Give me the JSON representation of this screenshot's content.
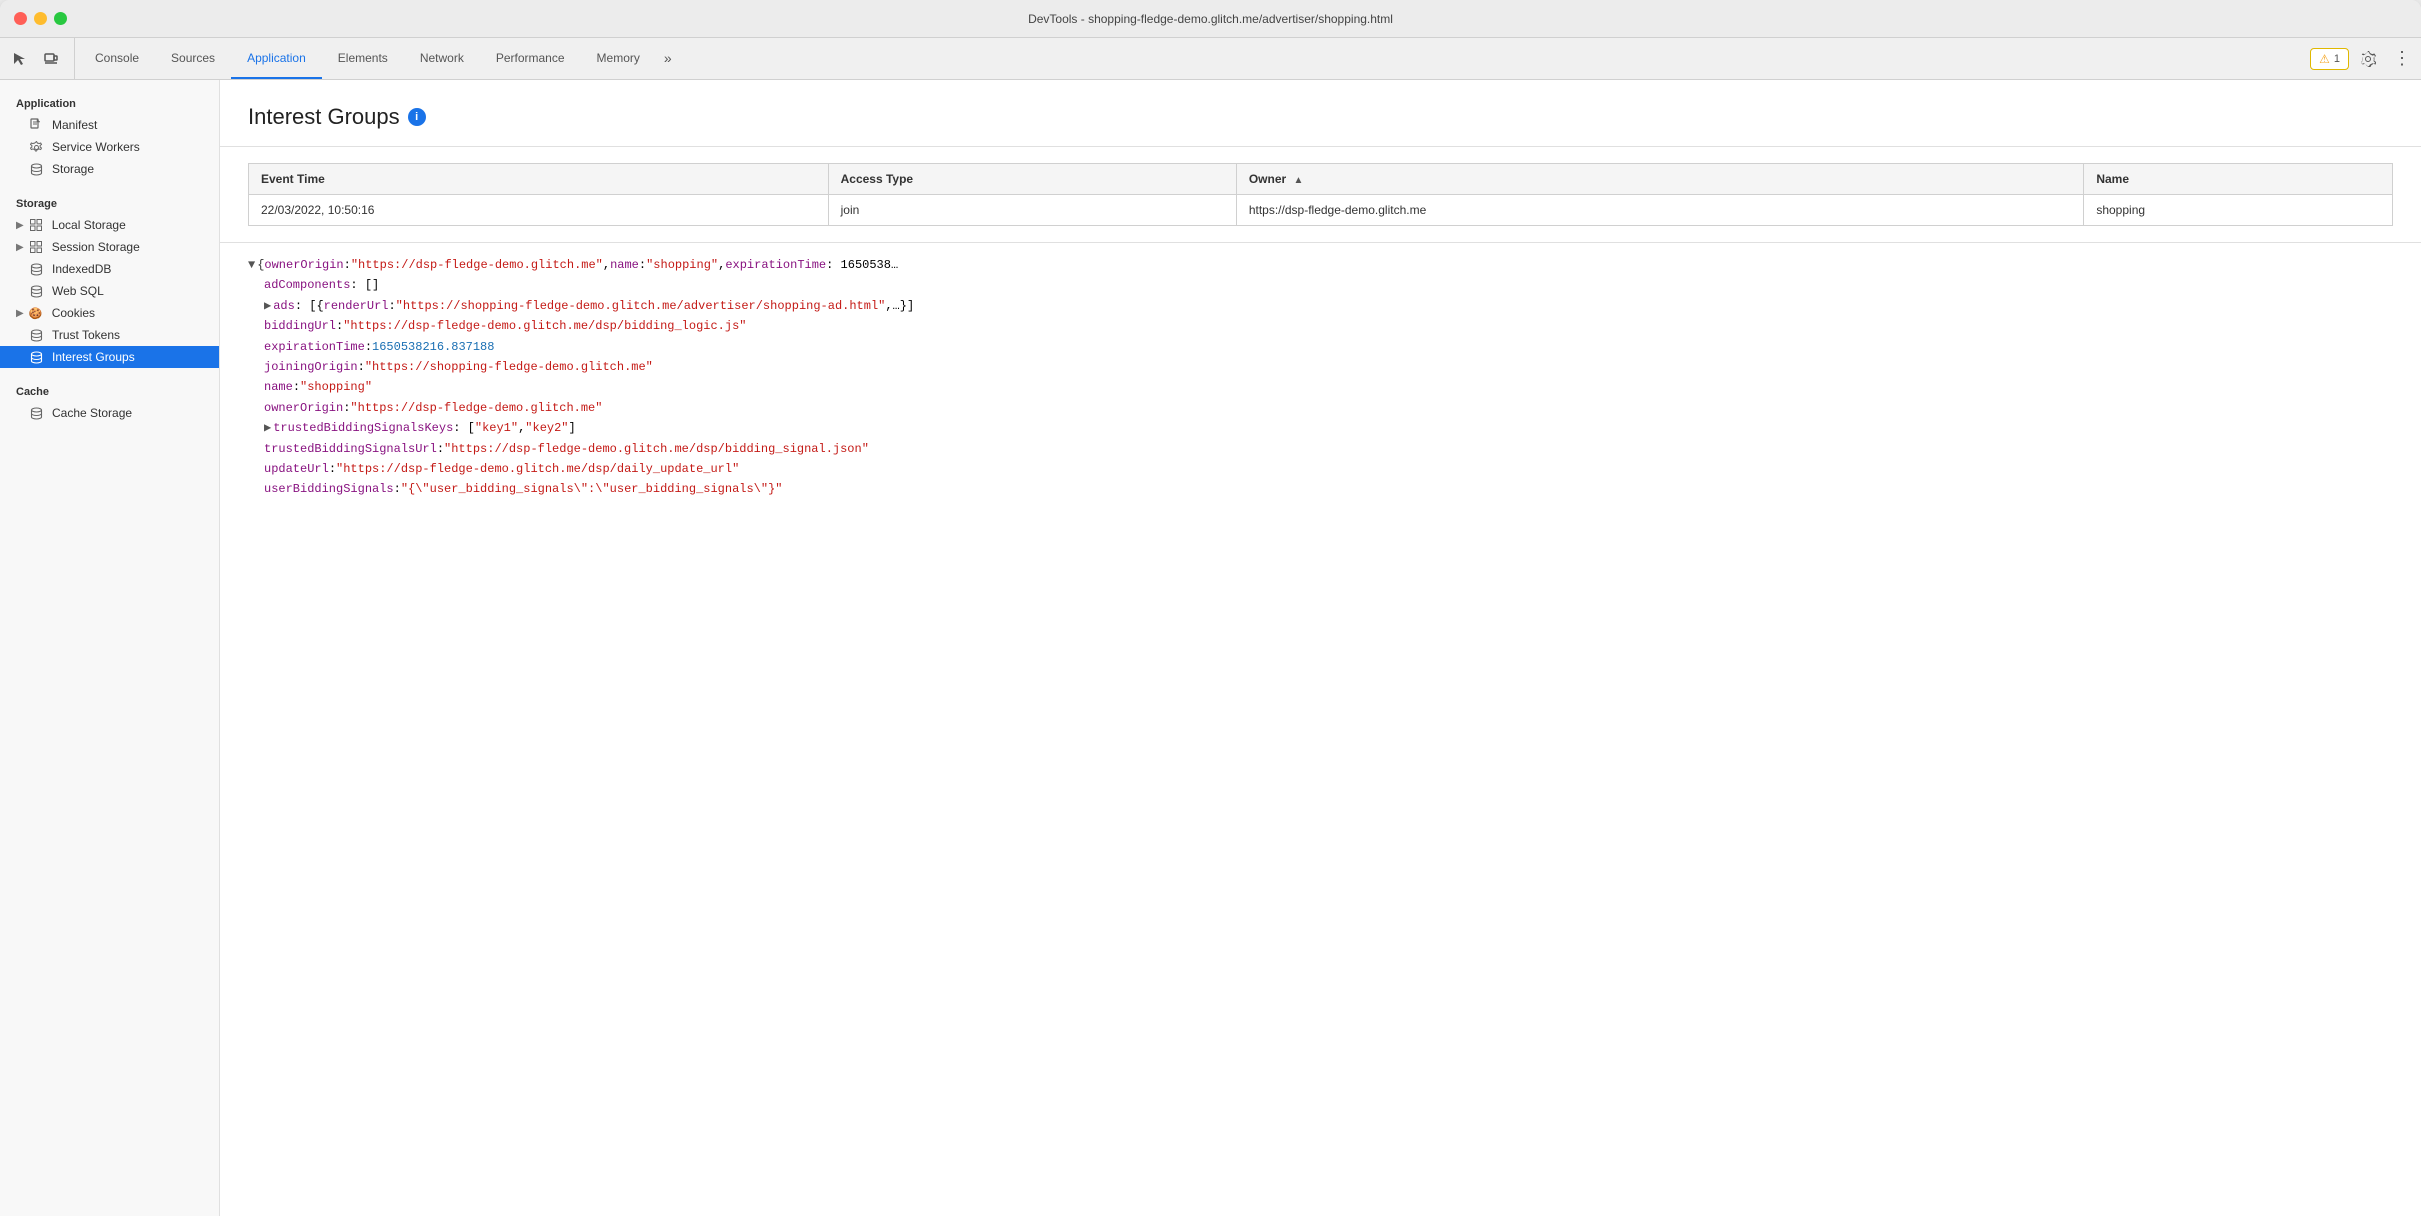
{
  "titlebar": {
    "title": "DevTools - shopping-fledge-demo.glitch.me/advertiser/shopping.html"
  },
  "toolbar": {
    "tabs": [
      {
        "id": "console",
        "label": "Console",
        "active": false
      },
      {
        "id": "sources",
        "label": "Sources",
        "active": false
      },
      {
        "id": "application",
        "label": "Application",
        "active": true
      },
      {
        "id": "elements",
        "label": "Elements",
        "active": false
      },
      {
        "id": "network",
        "label": "Network",
        "active": false
      },
      {
        "id": "performance",
        "label": "Performance",
        "active": false
      },
      {
        "id": "memory",
        "label": "Memory",
        "active": false
      }
    ],
    "more_label": "»",
    "warning_count": "1",
    "settings_icon": "⚙",
    "more_icon": "⋮"
  },
  "sidebar": {
    "sections": [
      {
        "label": "Application",
        "items": [
          {
            "id": "manifest",
            "label": "Manifest",
            "icon": "📄",
            "type": "file",
            "expandable": false
          },
          {
            "id": "service-workers",
            "label": "Service Workers",
            "icon": "⚙",
            "type": "gear",
            "expandable": false
          },
          {
            "id": "storage",
            "label": "Storage",
            "icon": "🗄",
            "type": "db",
            "expandable": false
          }
        ]
      },
      {
        "label": "Storage",
        "items": [
          {
            "id": "local-storage",
            "label": "Local Storage",
            "icon": "▦",
            "type": "grid",
            "expandable": true
          },
          {
            "id": "session-storage",
            "label": "Session Storage",
            "icon": "▦",
            "type": "grid",
            "expandable": true
          },
          {
            "id": "indexeddb",
            "label": "IndexedDB",
            "icon": "🗄",
            "type": "db",
            "expandable": false
          },
          {
            "id": "web-sql",
            "label": "Web SQL",
            "icon": "🗄",
            "type": "db",
            "expandable": false
          },
          {
            "id": "cookies",
            "label": "Cookies",
            "icon": "🍪",
            "type": "cookie",
            "expandable": true
          },
          {
            "id": "trust-tokens",
            "label": "Trust Tokens",
            "icon": "🗄",
            "type": "db",
            "expandable": false
          },
          {
            "id": "interest-groups",
            "label": "Interest Groups",
            "icon": "🗄",
            "type": "db",
            "expandable": false,
            "active": true
          }
        ]
      },
      {
        "label": "Cache",
        "items": [
          {
            "id": "cache-storage",
            "label": "Cache Storage",
            "icon": "🗄",
            "type": "db",
            "expandable": false
          }
        ]
      }
    ]
  },
  "content": {
    "title": "Interest Groups",
    "table": {
      "columns": [
        {
          "id": "event-time",
          "label": "Event Time",
          "sortable": false
        },
        {
          "id": "access-type",
          "label": "Access Type",
          "sortable": false
        },
        {
          "id": "owner",
          "label": "Owner",
          "sortable": true,
          "sort_dir": "asc"
        },
        {
          "id": "name",
          "label": "Name",
          "sortable": false
        }
      ],
      "rows": [
        {
          "event_time": "22/03/2022, 10:50:16",
          "access_type": "join",
          "owner": "https://dsp-fledge-demo.glitch.me",
          "name": "shopping"
        }
      ]
    },
    "json": {
      "line1_prefix": "▼ {ownerOrigin: \"https://dsp-fledge-demo.glitch.me\", name: \"shopping\", expirationTime: 1650538",
      "adComponents": "adComponents: []",
      "ads_prefix": "▶ ads: [{renderUrl: \"https://shopping-fledge-demo.glitch.me/advertiser/shopping-ad.html\",…}]",
      "biddingUrl_key": "biddingUrl:",
      "biddingUrl_val": "\"https://dsp-fledge-demo.glitch.me/dsp/bidding_logic.js\"",
      "expirationTime_key": "expirationTime:",
      "expirationTime_val": "1650538216.837188",
      "joiningOrigin_key": "joiningOrigin:",
      "joiningOrigin_val": "\"https://shopping-fledge-demo.glitch.me\"",
      "name_key": "name:",
      "name_val": "\"shopping\"",
      "ownerOrigin_key": "ownerOrigin:",
      "ownerOrigin_val": "\"https://dsp-fledge-demo.glitch.me\"",
      "trustedBiddingSignalsKeys_prefix": "▶ trustedBiddingSignalsKeys: [\"key1\", \"key2\"]",
      "trustedBiddingSignalsUrl_key": "trustedBiddingSignalsUrl:",
      "trustedBiddingSignalsUrl_val": "\"https://dsp-fledge-demo.glitch.me/dsp/bidding_signal.json\"",
      "updateUrl_key": "updateUrl:",
      "updateUrl_val": "\"https://dsp-fledge-demo.glitch.me/dsp/daily_update_url\"",
      "userBiddingSignals_key": "userBiddingSignals:",
      "userBiddingSignals_val": "\"{\\\"user_bidding_signals\\\":\\\"user_bidding_signals\\\"}\""
    }
  }
}
